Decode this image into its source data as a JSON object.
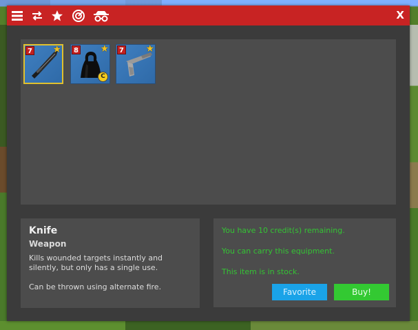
{
  "titlebar": {
    "icons": [
      "menu-icon",
      "swap-icon",
      "star-icon",
      "radar-icon",
      "disguise-icon"
    ],
    "close_label": "X",
    "color": "#c82323"
  },
  "items": [
    {
      "name": "Knife",
      "cost": "7",
      "favorite": true,
      "selected": true,
      "icon": "knife-icon"
    },
    {
      "name": "Cloak",
      "cost": "8",
      "favorite": true,
      "selected": false,
      "icon": "cloak-icon",
      "extra_badge": "C"
    },
    {
      "name": "Silenced Pistol",
      "cost": "7",
      "favorite": true,
      "selected": false,
      "icon": "pistol-icon"
    }
  ],
  "description": {
    "name": "Knife",
    "type": "Weapon",
    "text": "Kills wounded targets instantly and silently, but only has a single use.",
    "text2": "Can be thrown using alternate fire."
  },
  "status": {
    "credits": "You have 10 credit(s) remaining.",
    "carry": "You can carry this equipment.",
    "stock": "This item is in stock.",
    "color": "#34c434"
  },
  "buttons": {
    "favorite_label": "Favorite",
    "buy_label": "Buy!",
    "favorite_color": "#1aa3e8",
    "buy_color": "#33c932"
  }
}
